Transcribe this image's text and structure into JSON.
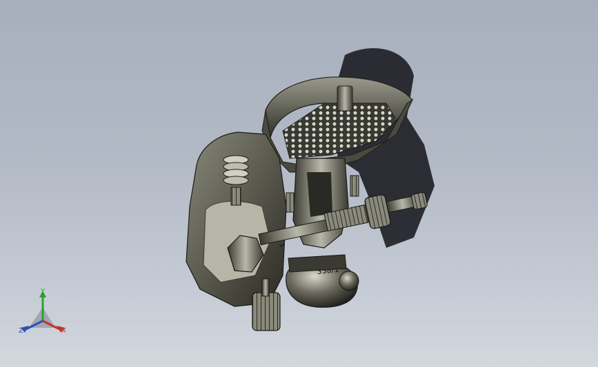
{
  "viewport": {
    "background_top": "#a7afbd",
    "background_bottom": "#d3d8de"
  },
  "model": {
    "part_mark": "338/1",
    "valve_mark": "S"
  },
  "triad": {
    "x_label": "X",
    "y_label": "Y",
    "z_label": "Z",
    "x_color": "#c0342c",
    "y_color": "#2f9e2f",
    "z_color": "#2f4fb0"
  }
}
